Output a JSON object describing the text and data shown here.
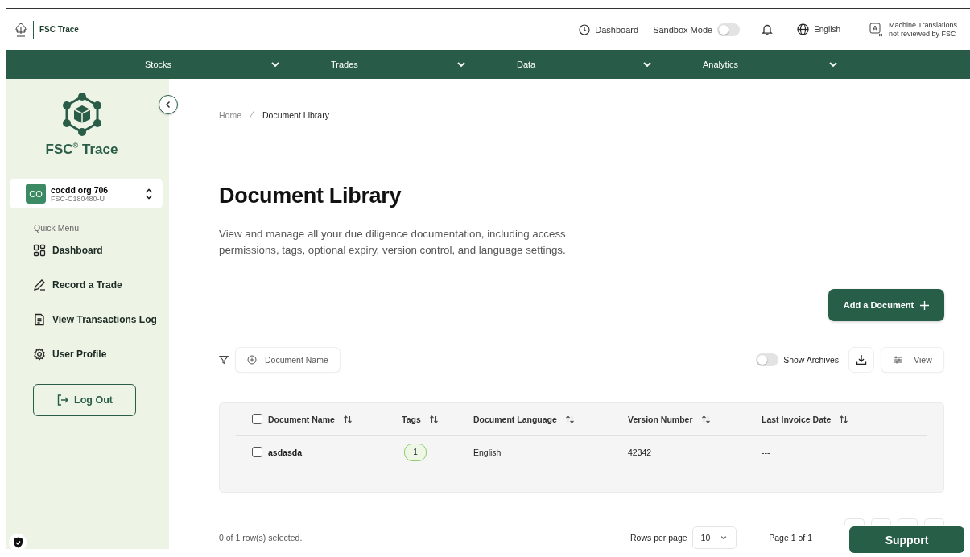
{
  "header": {
    "logo_text": "FSC Trace",
    "dashboard_link": "Dashboard",
    "sandbox": {
      "label": "Sandbox Mode",
      "on": false
    },
    "language": "English",
    "translation_note": [
      "Machine Translations",
      "not reviewed by FSC"
    ]
  },
  "nav": [
    {
      "label": "Stocks"
    },
    {
      "label": "Trades"
    },
    {
      "label": "Data"
    },
    {
      "label": "Analytics"
    }
  ],
  "sidebar": {
    "brand": "FSC$^{®}$ Trace",
    "org": {
      "initials": "CO",
      "name": "cocdd org 706",
      "code": "FSC-C180480-U"
    },
    "quick_menu_label": "Quick Menu",
    "items": [
      {
        "label": "Dashboard",
        "kind": "grid"
      },
      {
        "label": "Record a Trade",
        "kind": "pen"
      },
      {
        "label": "View Transactions Log",
        "kind": "document"
      },
      {
        "label": "User Profile",
        "kind": "gear"
      }
    ],
    "logout": "Log Out"
  },
  "main": {
    "breadcrumb": [
      {
        "label": "Home",
        "current": false
      },
      {
        "label": "Document Library",
        "current": true
      }
    ],
    "title": "Document Library",
    "description": "View and manage all your due diligence documentation, including access permissions, tags, optional expiry, version control, and language settings.",
    "add_button": "Add a Document",
    "filter_chip": "Document Name",
    "show_archives": {
      "label": "Show Archives",
      "on": false
    },
    "view_button": "View",
    "table": {
      "all_checked": false,
      "columns": [
        "Document Name",
        "Tags",
        "Document Language",
        "Version Number",
        "Last Invoice Date"
      ],
      "rows": [
        {
          "selected": false,
          "document_name": "asdasda",
          "tags": "1",
          "document_language": "English",
          "version_number": "42342",
          "last_invoice_date": "---"
        }
      ]
    },
    "selection_text": "0 of 1 row(s) selected.",
    "rows_per_page_label": "Rows per page",
    "rows_per_page": "10",
    "page_label": "Page 1 of 1"
  },
  "support_button": "Support"
}
